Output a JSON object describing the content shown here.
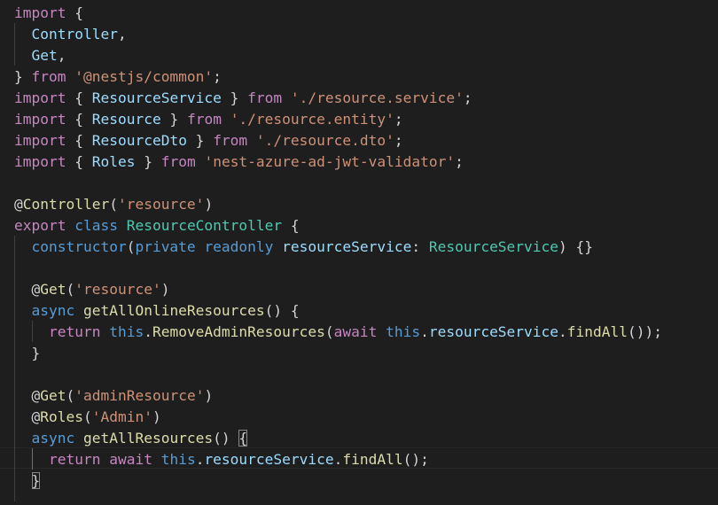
{
  "editor": {
    "lines": [
      [
        [
          "kw",
          "import"
        ],
        [
          "txt",
          " {"
        ]
      ],
      [
        [
          "txt",
          "  "
        ],
        [
          "var",
          "Controller"
        ],
        [
          "txt",
          ","
        ]
      ],
      [
        [
          "txt",
          "  "
        ],
        [
          "var",
          "Get"
        ],
        [
          "txt",
          ","
        ]
      ],
      [
        [
          "txt",
          "} "
        ],
        [
          "kw",
          "from"
        ],
        [
          "txt",
          " "
        ],
        [
          "str",
          "'@nestjs/common'"
        ],
        [
          "txt",
          ";"
        ]
      ],
      [
        [
          "kw",
          "import"
        ],
        [
          "txt",
          " { "
        ],
        [
          "var",
          "ResourceService"
        ],
        [
          "txt",
          " } "
        ],
        [
          "kw",
          "from"
        ],
        [
          "txt",
          " "
        ],
        [
          "str",
          "'./resource.service'"
        ],
        [
          "txt",
          ";"
        ]
      ],
      [
        [
          "kw",
          "import"
        ],
        [
          "txt",
          " { "
        ],
        [
          "var",
          "Resource"
        ],
        [
          "txt",
          " } "
        ],
        [
          "kw",
          "from"
        ],
        [
          "txt",
          " "
        ],
        [
          "str",
          "'./resource.entity'"
        ],
        [
          "txt",
          ";"
        ]
      ],
      [
        [
          "kw",
          "import"
        ],
        [
          "txt",
          " { "
        ],
        [
          "var",
          "ResourceDto"
        ],
        [
          "txt",
          " } "
        ],
        [
          "kw",
          "from"
        ],
        [
          "txt",
          " "
        ],
        [
          "str",
          "'./resource.dto'"
        ],
        [
          "txt",
          ";"
        ]
      ],
      [
        [
          "kw",
          "import"
        ],
        [
          "txt",
          " { "
        ],
        [
          "var",
          "Roles"
        ],
        [
          "txt",
          " } "
        ],
        [
          "kw",
          "from"
        ],
        [
          "txt",
          " "
        ],
        [
          "str",
          "'nest-azure-ad-jwt-validator'"
        ],
        [
          "txt",
          ";"
        ]
      ],
      [],
      [
        [
          "txt",
          "@"
        ],
        [
          "fn",
          "Controller"
        ],
        [
          "txt",
          "("
        ],
        [
          "str",
          "'resource'"
        ],
        [
          "txt",
          ")"
        ]
      ],
      [
        [
          "kw",
          "export"
        ],
        [
          "txt",
          " "
        ],
        [
          "kwb",
          "class"
        ],
        [
          "txt",
          " "
        ],
        [
          "cls",
          "ResourceController"
        ],
        [
          "txt",
          " {"
        ]
      ],
      [
        [
          "txt",
          "  "
        ],
        [
          "kwb",
          "constructor"
        ],
        [
          "txt",
          "("
        ],
        [
          "kwb",
          "private"
        ],
        [
          "txt",
          " "
        ],
        [
          "kwb",
          "readonly"
        ],
        [
          "txt",
          " "
        ],
        [
          "var",
          "resourceService"
        ],
        [
          "txt",
          ": "
        ],
        [
          "cls",
          "ResourceService"
        ],
        [
          "txt",
          ") {}"
        ]
      ],
      [],
      [
        [
          "txt",
          "  @"
        ],
        [
          "fn",
          "Get"
        ],
        [
          "txt",
          "("
        ],
        [
          "str",
          "'resource'"
        ],
        [
          "txt",
          ")"
        ]
      ],
      [
        [
          "txt",
          "  "
        ],
        [
          "kwb",
          "async"
        ],
        [
          "txt",
          " "
        ],
        [
          "fn",
          "getAllOnlineResources"
        ],
        [
          "txt",
          "() {"
        ]
      ],
      [
        [
          "txt",
          "    "
        ],
        [
          "kw",
          "return"
        ],
        [
          "txt",
          " "
        ],
        [
          "kwb",
          "this"
        ],
        [
          "txt",
          "."
        ],
        [
          "fn",
          "RemoveAdminResources"
        ],
        [
          "txt",
          "("
        ],
        [
          "kw",
          "await"
        ],
        [
          "txt",
          " "
        ],
        [
          "kwb",
          "this"
        ],
        [
          "txt",
          "."
        ],
        [
          "var",
          "resourceService"
        ],
        [
          "txt",
          "."
        ],
        [
          "fn",
          "findAll"
        ],
        [
          "txt",
          "());"
        ]
      ],
      [
        [
          "txt",
          "  }"
        ]
      ],
      [],
      [
        [
          "txt",
          "  @"
        ],
        [
          "fn",
          "Get"
        ],
        [
          "txt",
          "("
        ],
        [
          "str",
          "'adminResource'"
        ],
        [
          "txt",
          ")"
        ]
      ],
      [
        [
          "txt",
          "  @"
        ],
        [
          "fn",
          "Roles"
        ],
        [
          "txt",
          "("
        ],
        [
          "str",
          "'Admin'"
        ],
        [
          "txt",
          ")"
        ]
      ],
      [
        [
          "txt",
          "  "
        ],
        [
          "kwb",
          "async"
        ],
        [
          "txt",
          " "
        ],
        [
          "fn",
          "getAllResources"
        ],
        [
          "txt",
          "() "
        ],
        [
          "br",
          "{"
        ]
      ],
      [
        [
          "txt",
          "    "
        ],
        [
          "kw",
          "return"
        ],
        [
          "txt",
          " "
        ],
        [
          "kw",
          "await"
        ],
        [
          "txt",
          " "
        ],
        [
          "kwb",
          "this"
        ],
        [
          "txt",
          "."
        ],
        [
          "var",
          "resourceService"
        ],
        [
          "txt",
          "."
        ],
        [
          "fn",
          "findAll"
        ],
        [
          "txt",
          "();"
        ]
      ],
      [
        [
          "txt",
          "  "
        ],
        [
          "br",
          "}"
        ]
      ]
    ]
  }
}
